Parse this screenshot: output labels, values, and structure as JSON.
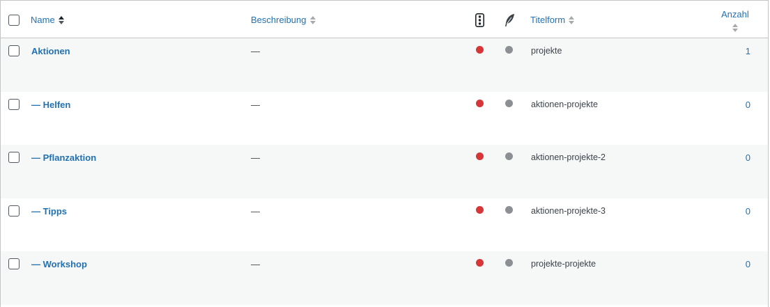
{
  "header": {
    "name_label": "Name",
    "description_label": "Beschreibung",
    "slug_label": "Titelform",
    "count_label": "Anzahl",
    "status_icon": "traffic-light-icon",
    "quill_icon": "quill-icon"
  },
  "colors": {
    "link": "#2271b1",
    "status_red": "#d63638",
    "status_grey": "#8c8f94",
    "row_alt": "#f6f7f7"
  },
  "rows": [
    {
      "name": "Aktionen",
      "description": "—",
      "slug": "projekte",
      "count": "1"
    },
    {
      "name": "— Helfen",
      "description": "—",
      "slug": "aktionen-projekte",
      "count": "0"
    },
    {
      "name": "— Pflanzaktion",
      "description": "—",
      "slug": "aktionen-projekte-2",
      "count": "0"
    },
    {
      "name": "— Tipps",
      "description": "—",
      "slug": "aktionen-projekte-3",
      "count": "0"
    },
    {
      "name": "— Workshop",
      "description": "—",
      "slug": "projekte-projekte",
      "count": "0"
    }
  ]
}
